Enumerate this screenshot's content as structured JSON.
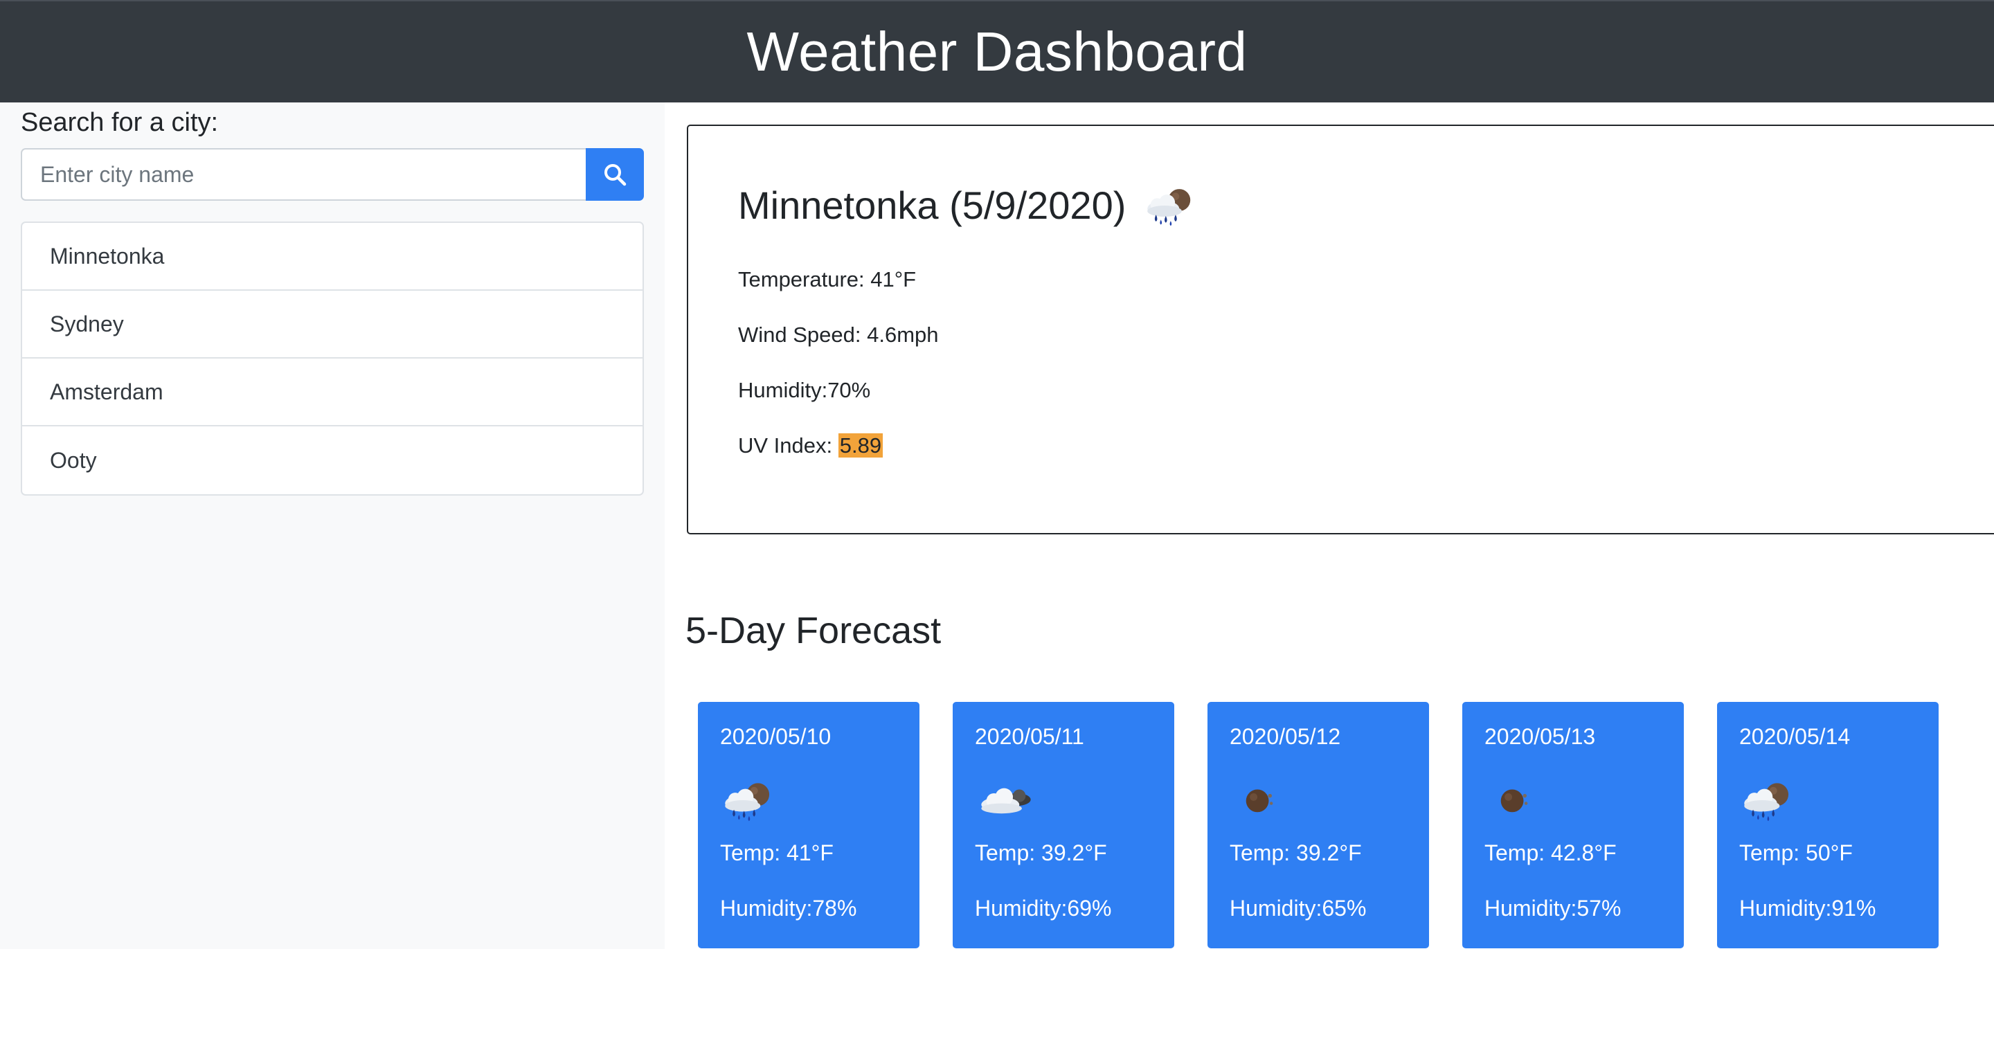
{
  "header": {
    "title": "Weather Dashboard"
  },
  "search": {
    "label": "Search for a city:",
    "placeholder": "Enter city name",
    "value": ""
  },
  "history": {
    "cities": [
      "Minnetonka",
      "Sydney",
      "Amsterdam",
      "Ooty"
    ]
  },
  "current": {
    "title": "Minnetonka (5/9/2020)",
    "icon": "rain-cloud-icon",
    "temperature": "Temperature: 41°F",
    "wind": "Wind Speed: 4.6mph",
    "humidity": "Humidity:70%",
    "uv_label": "UV Index: ",
    "uv_value": "5.89",
    "uv_color": "#f2a33a"
  },
  "forecast": {
    "title": "5-Day Forecast",
    "card_color": "#2f7ff3",
    "days": [
      {
        "date": "2020/05/10",
        "icon": "rain-cloud-icon",
        "temp": "Temp: 41°F",
        "humidity": "Humidity:78%"
      },
      {
        "date": "2020/05/11",
        "icon": "cloudy-icon",
        "temp": "Temp: 39.2°F",
        "humidity": "Humidity:69%"
      },
      {
        "date": "2020/05/12",
        "icon": "moon-icon",
        "temp": "Temp: 39.2°F",
        "humidity": "Humidity:65%"
      },
      {
        "date": "2020/05/13",
        "icon": "moon-icon",
        "temp": "Temp: 42.8°F",
        "humidity": "Humidity:57%"
      },
      {
        "date": "2020/05/14",
        "icon": "rain-cloud-icon",
        "temp": "Temp: 50°F",
        "humidity": "Humidity:91%"
      }
    ]
  }
}
